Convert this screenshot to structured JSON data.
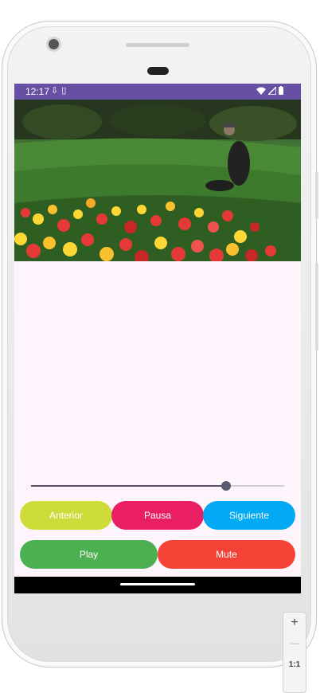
{
  "status_bar": {
    "time": "12:17",
    "left_icons": [
      "download-icon",
      "sim-icon"
    ],
    "right_icons": [
      "wifi-icon",
      "signal-icon",
      "battery-icon"
    ],
    "color": "#6750a4"
  },
  "video": {
    "description_icon": "video-frame"
  },
  "player": {
    "progress": 0.77
  },
  "controls": {
    "anterior": "Anterior",
    "pausa": "Pausa",
    "siguiente": "Siguiente",
    "play": "Play",
    "mute": "Mute"
  },
  "colors": {
    "anterior": "#cddc39",
    "pausa": "#e91e63",
    "siguiente": "#03a9f4",
    "play": "#4caf50",
    "mute": "#f44336",
    "screen_bg": "#fdf5fb"
  },
  "emulator_zoom": {
    "zoom_in": "+",
    "zoom_out": "—",
    "ratio": "1:1"
  }
}
